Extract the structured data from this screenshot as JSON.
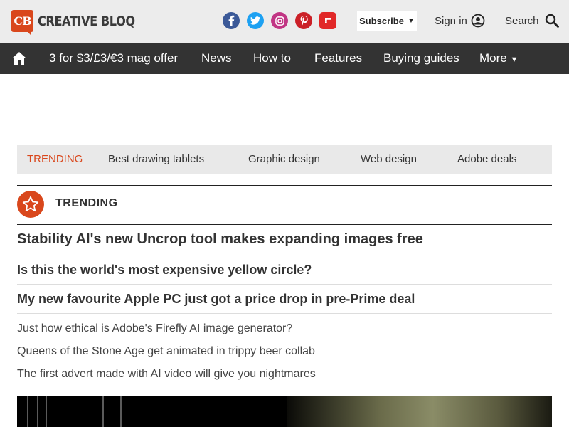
{
  "header": {
    "logo_badge": "CB",
    "logo_text": "CREATIVE BLOQ",
    "socials": [
      "facebook-icon",
      "twitter-icon",
      "instagram-icon",
      "pinterest-icon",
      "flipboard-icon"
    ],
    "subscribe_label": "Subscribe",
    "signin_label": "Sign in",
    "search_label": "Search"
  },
  "nav": {
    "items": [
      "3 for $3/£3/€3 mag offer",
      "News",
      "How to",
      "Features",
      "Buying guides",
      "More"
    ]
  },
  "trending_strip": {
    "label": "TRENDING",
    "links": [
      "Best drawing tablets",
      "Graphic design",
      "Web design",
      "Adobe deals"
    ]
  },
  "trending": {
    "heading": "TRENDING",
    "headlines": [
      "Stability AI's new Uncrop tool makes expanding images free",
      "Is this the world's most expensive yellow circle?",
      "My new favourite Apple PC just got a price drop in pre-Prime deal"
    ],
    "links": [
      "Just how ethical is Adobe's Firefly AI image generator?",
      "Queens of the Stone Age get animated in trippy beer collab",
      "The first advert made with AI video will give you nightmares"
    ]
  },
  "colors": {
    "brand": "#d9471c",
    "nav_bg": "#333333",
    "header_bg": "#ececec"
  }
}
